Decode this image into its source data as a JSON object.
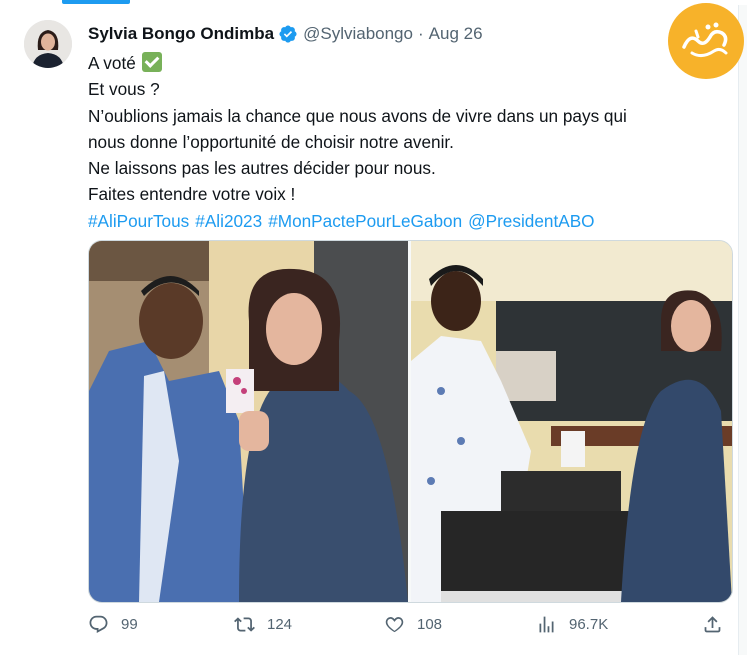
{
  "tweet": {
    "author_name": "Sylvia Bongo Ondimba",
    "handle": "@Sylviabongo",
    "separator": "·",
    "date": "Aug 26",
    "lines": [
      "A voté",
      "Et vous ?",
      "N’oublions jamais la chance que nous avons de vivre dans un pays qui",
      "nous donne l’opportunité de choisir notre avenir.",
      "Ne laissons pas les autres décider pour nous.",
      "Faites entendre votre voix !"
    ],
    "hashtags": [
      "#AliPourTous",
      "#Ali2023",
      "#MonPactePourLeGabon",
      "@PresidentABO"
    ]
  },
  "actions": {
    "reply_count": "99",
    "retweet_count": "124",
    "like_count": "108",
    "views_count": "96.7K"
  },
  "icons": {
    "verified": "verified-badge-icon",
    "check": "check-mark-emoji-icon",
    "reply": "reply-icon",
    "retweet": "retweet-icon",
    "like": "heart-icon",
    "views": "views-chart-icon",
    "share": "share-icon",
    "watermark": "watermark-logo"
  },
  "colors": {
    "accent": "#1d9bf0",
    "text": "#0f1419",
    "secondary": "#536471",
    "check": "#78b159",
    "watermark": "#f7b22a"
  }
}
